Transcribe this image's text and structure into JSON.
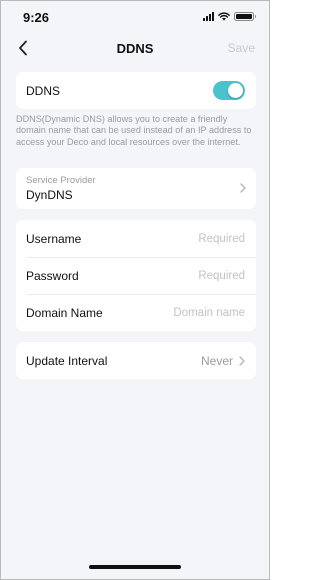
{
  "status_bar": {
    "time": "9:26"
  },
  "nav": {
    "title": "DDNS",
    "save_label": "Save"
  },
  "ddns": {
    "label": "DDNS",
    "enabled": true
  },
  "description": "DDNS(Dynamic DNS) allows you to create a friendly domain name that can be used instead of an IP address to access your Deco and local resources over the internet.",
  "service_provider": {
    "label": "Service Provider",
    "value": "DynDNS"
  },
  "credentials": {
    "username": {
      "label": "Username",
      "placeholder": "Required"
    },
    "password": {
      "label": "Password",
      "placeholder": "Required"
    },
    "domain_name": {
      "label": "Domain Name",
      "placeholder": "Domain name"
    }
  },
  "update_interval": {
    "label": "Update Interval",
    "value": "Never"
  },
  "colors": {
    "toggle_on": "#4ac3cf",
    "background": "#f4f5f9"
  },
  "icons": [
    "back-chevron-icon",
    "chevron-right-icon",
    "signal-icon",
    "wifi-icon",
    "battery-icon"
  ]
}
